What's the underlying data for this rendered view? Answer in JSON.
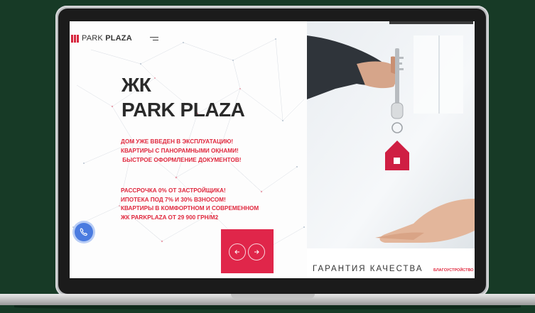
{
  "brand": {
    "logo_light": "PARK ",
    "logo_bold": "PLAZA"
  },
  "hero": {
    "title_line1": "ЖК",
    "title_line2": "PARK PLAZA"
  },
  "features": [
    "ДОМ УЖЕ ВВЕДЕН В ЭКСПЛУАТАЦИЮ!",
    "КВАРТИРЫ С ПАНОРАМНЫМИ ОКНАМИ!",
    " БЫСТРОЕ ОФОРМЛЕНИЕ ДОКУМЕНТОВ!"
  ],
  "promo": [
    "РАССРОЧКА 0% ОТ ЗАСТРОЙЩИКА!",
    "ИПОТЕКА ПОД 7% И 30% ВЗНОСОМ!",
    "КВАРТИРЫ В КОМФОРТНОМ И СОВРЕМЕННОМ",
    "ЖК PARKPLAZA ОТ 29 900 ГРН/М2"
  ],
  "slide": {
    "caption": "ГАРАНТИЯ КАЧЕСТВА",
    "tag": "БЛАГОУСТРОЙСТВО"
  },
  "icons": {
    "prev": "arrow-left-icon",
    "next": "arrow-right-icon",
    "callback": "phone-icon",
    "menu": "menu-icon"
  },
  "colors": {
    "accent": "#e0264a",
    "callback": "#4a7be0",
    "background": "#173a26"
  }
}
